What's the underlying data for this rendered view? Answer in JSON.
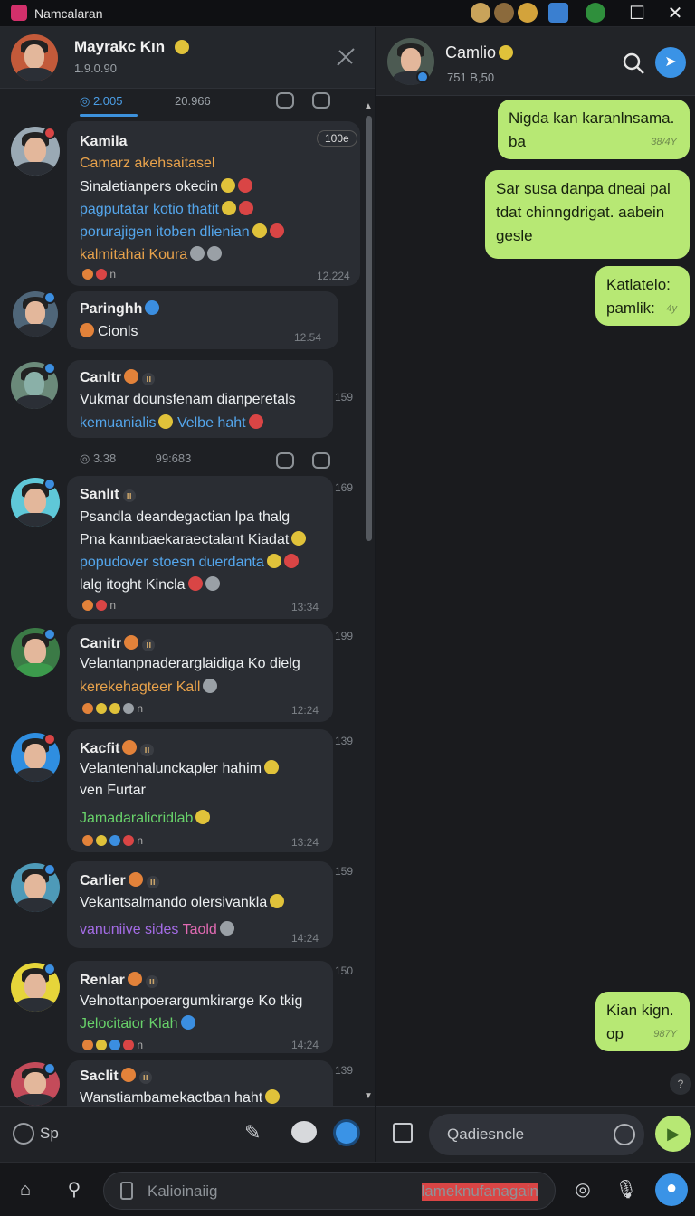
{
  "window": {
    "title": "Namcalaran",
    "controls": {
      "maximize": "☐",
      "close": "✕"
    }
  },
  "left_header": {
    "name": "Mayrakc Kın",
    "status": "1.9.0.90"
  },
  "tabs": [
    {
      "label": "◎ 2.005"
    },
    {
      "label": "20.966"
    }
  ],
  "conversations": [
    {
      "name": "Kamila",
      "badge": "",
      "corner": "100e",
      "lines": [
        {
          "text": "Camarz akehsaitasel",
          "color": "orange"
        },
        {
          "text": "Sinaletianpers okedin",
          "color": "white"
        },
        {
          "text": "pagputatar kotio thatit",
          "color": "blue"
        },
        {
          "text": "porurajigen itoben dlienian",
          "color": "blue"
        },
        {
          "text": "kalmitahai Koura",
          "color": "orange"
        }
      ],
      "reactions": "n",
      "time": "12.224",
      "side": ""
    },
    {
      "name": "Paringhh",
      "badge": "",
      "corner": "",
      "lines": [
        {
          "text": "Cionls",
          "color": "white"
        }
      ],
      "reactions": "",
      "time": "12.54",
      "side": ""
    },
    {
      "name": "Canltr",
      "badge": "ıı",
      "corner": "",
      "lines": [
        {
          "text": "Vukmar dounsfenam dianperetals",
          "color": "white"
        },
        {
          "text": "kemuanialis",
          "color": "blue"
        }
      ],
      "extra_text": "Velbe haht",
      "reactions": "",
      "time": "",
      "side": "159"
    },
    {
      "name": "Sanlıt",
      "badge": "ıı",
      "corner": "",
      "lines": [
        {
          "text": "Psandla deandegactian lpa thalg",
          "color": "white"
        },
        {
          "text": "Pna kannbaekaraectalant Kiadat",
          "color": "white"
        },
        {
          "text": "popudover stoesn duerdanta",
          "color": "blue"
        },
        {
          "text": "lalg itoght Kincla",
          "color": "white"
        }
      ],
      "reactions": "n",
      "time": "13:34",
      "side": "169"
    },
    {
      "name": "Canitr",
      "badge": "ıı",
      "corner": "",
      "lines": [
        {
          "text": "Velantanpnaderarglaidiga Ko dielg",
          "color": "white"
        },
        {
          "text": "kerekehagteer Kall",
          "color": "orange"
        }
      ],
      "reactions": "n",
      "time": "12:24",
      "side": "199"
    },
    {
      "name": "Kacfit",
      "badge": "ıı",
      "corner": "",
      "lines": [
        {
          "text": "Velantenhalunckapler hahim",
          "color": "white"
        },
        {
          "text": "ven Furtar",
          "color": "white"
        },
        {
          "text": "Jamadaralicridlab",
          "color": "green"
        }
      ],
      "reactions": "n",
      "time": "13:24",
      "side": "139"
    },
    {
      "name": "Carlier",
      "badge": "ıı",
      "corner": "",
      "lines": [
        {
          "text": "Vekantsalmando olersivankla",
          "color": "white"
        },
        {
          "text": "vanuniive sides",
          "color": "purple"
        }
      ],
      "extra_text": "Taold",
      "reactions": "",
      "time": "14:24",
      "side": "159"
    },
    {
      "name": "Renlar",
      "badge": "ıı",
      "corner": "",
      "lines": [
        {
          "text": "Velnottanpoerargumkirarge Ko tkig",
          "color": "white"
        },
        {
          "text": "Jelocitaior Klah",
          "color": "green"
        }
      ],
      "reactions": "n",
      "time": "14:24",
      "side": "150"
    },
    {
      "name": "Saclit",
      "badge": "ıı",
      "corner": "",
      "lines": [
        {
          "text": "Wanstiambamekactban haht",
          "color": "white"
        }
      ],
      "reactions": "",
      "time": "",
      "side": "139"
    }
  ],
  "dividers": [
    {
      "left": "◎ 3.38",
      "right": "99:683"
    }
  ],
  "left_composer": {
    "label": "Sp"
  },
  "chat": {
    "name": "Camlio",
    "status": "751 B,50",
    "messages": [
      {
        "text": "Nigda kan karanlnsama. ba",
        "time": "38/4Y"
      },
      {
        "text": "Sar susa danpa dneai pal tdat chinngdrigat. aabein gesle",
        "time": ""
      },
      {
        "text": "Katlatelo: pamlik:",
        "time": "4y"
      },
      {
        "text": "Kian kign. op",
        "time": "987Y"
      }
    ],
    "composer_placeholder": "Qadiesncle"
  },
  "bottom": {
    "placeholder_left": "Kalioinaiig",
    "placeholder_right": "lameknufanagain"
  },
  "colors": {
    "accent": "#3a93e6",
    "outgoing_bubble": "#b7e874",
    "incoming_bubble": "#2a2d33"
  }
}
